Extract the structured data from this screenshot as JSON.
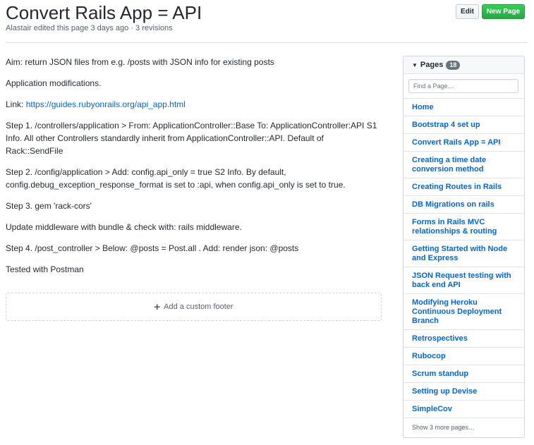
{
  "page": {
    "title": "Convert Rails App = API",
    "meta": "Alastair edited this page 3 days ago · 3 revisions"
  },
  "actions": {
    "edit_label": "Edit",
    "new_page_label": "New Page"
  },
  "content": {
    "aim": "Aim: return JSON files from e.g. /posts with JSON info for existing posts",
    "modifications": "Application modifications.",
    "link_prefix": "Link: ",
    "link_text": "https://guides.rubyonrails.org/api_app.html",
    "step1": "Step 1. /controllers/application > From: ApplicationController::Base To: ApplicationController:API S1 Info. All other Controllers standardly inherit from ApplicationController::API. Default of Rack::SendFile",
    "step2": "Step 2. /config/application > Add: config.api_only = true S2 Info. By default, config.debug_exception_response_format is set to :api, when config.api_only is set to true.",
    "step3": "Step 3. gem 'rack-cors'",
    "update": "Update middleware with bundle & check with: rails middleware.",
    "step4": "Step 4. /post_controller > Below: @posts = Post.all . Add: render json: @posts",
    "tested": "Tested with Postman"
  },
  "footer": {
    "add_label": "Add a custom footer"
  },
  "sidebar": {
    "heading": "Pages",
    "count": "18",
    "search_placeholder": "Find a Page…",
    "items": [
      {
        "label": "Home",
        "lines": 1
      },
      {
        "label": "Bootstrap 4 set up",
        "lines": 1
      },
      {
        "label": "Convert Rails App = API",
        "lines": 1
      },
      {
        "label": "Creating a time date conversion method",
        "lines": 2
      },
      {
        "label": "Creating Routes in Rails",
        "lines": 1
      },
      {
        "label": "DB Migrations on rails",
        "lines": 1
      },
      {
        "label": "Forms in Rails MVC relationships & routing",
        "lines": 2
      },
      {
        "label": "Getting Started with Node and Express",
        "lines": 2
      },
      {
        "label": "JSON Request testing with back end API",
        "lines": 2
      },
      {
        "label": "Modifying Heroku Continuous Deployment Branch",
        "lines": 3
      },
      {
        "label": "Retrospectives",
        "lines": 1
      },
      {
        "label": "Rubocop",
        "lines": 1
      },
      {
        "label": "Scrum standup",
        "lines": 1
      },
      {
        "label": "Setting up Devise",
        "lines": 1
      },
      {
        "label": "SimpleCov",
        "lines": 1
      }
    ],
    "show_more": "Show 3 more pages…"
  },
  "colors": {
    "link": "#0366d6",
    "new_page_button": "#2cbe4e",
    "text": "#24292e",
    "muted": "#586069"
  },
  "icons": [
    "caret-down-icon",
    "plus-icon"
  ]
}
